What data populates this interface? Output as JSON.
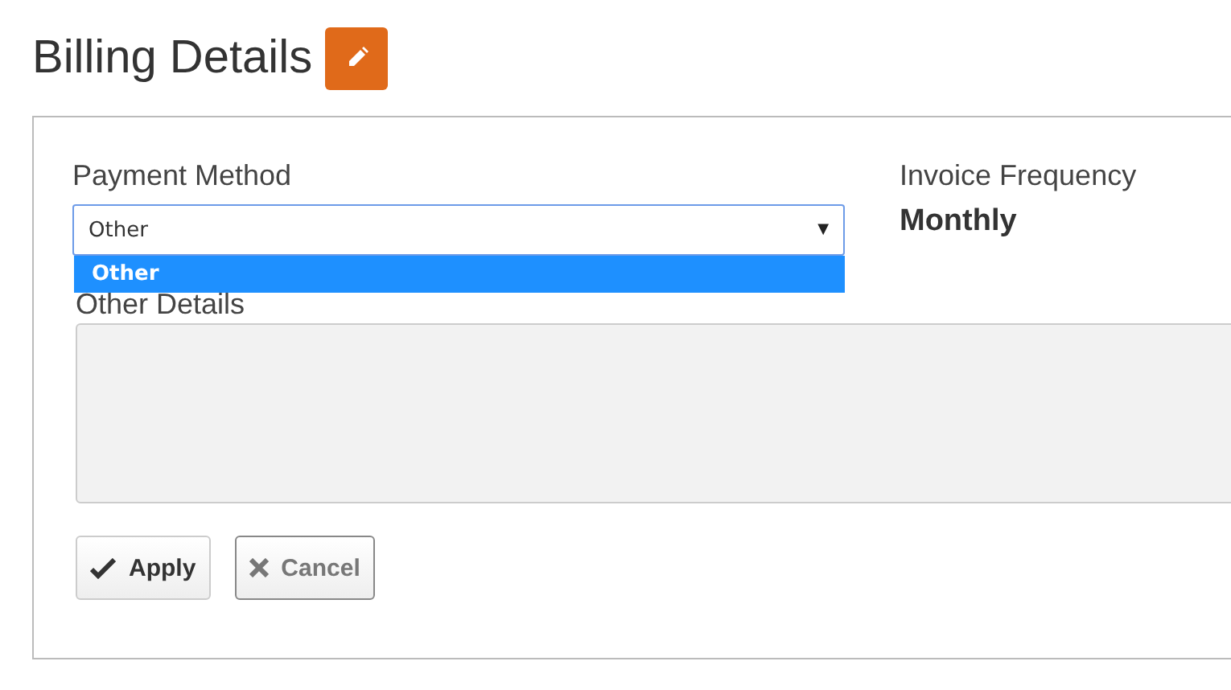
{
  "title": "Billing Details",
  "payment_method": {
    "label": "Payment Method",
    "value": "Other",
    "caret": "▼",
    "expanded": true,
    "options": [
      {
        "label": "Other",
        "selected": true
      }
    ]
  },
  "invoice_frequency": {
    "label": "Invoice Frequency",
    "value": "Monthly"
  },
  "other_details": {
    "label": "Other Details"
  },
  "buttons": [
    {
      "label": "Apply",
      "kind": "apply"
    },
    {
      "label": "Cancel",
      "kind": "cancel"
    }
  ]
}
